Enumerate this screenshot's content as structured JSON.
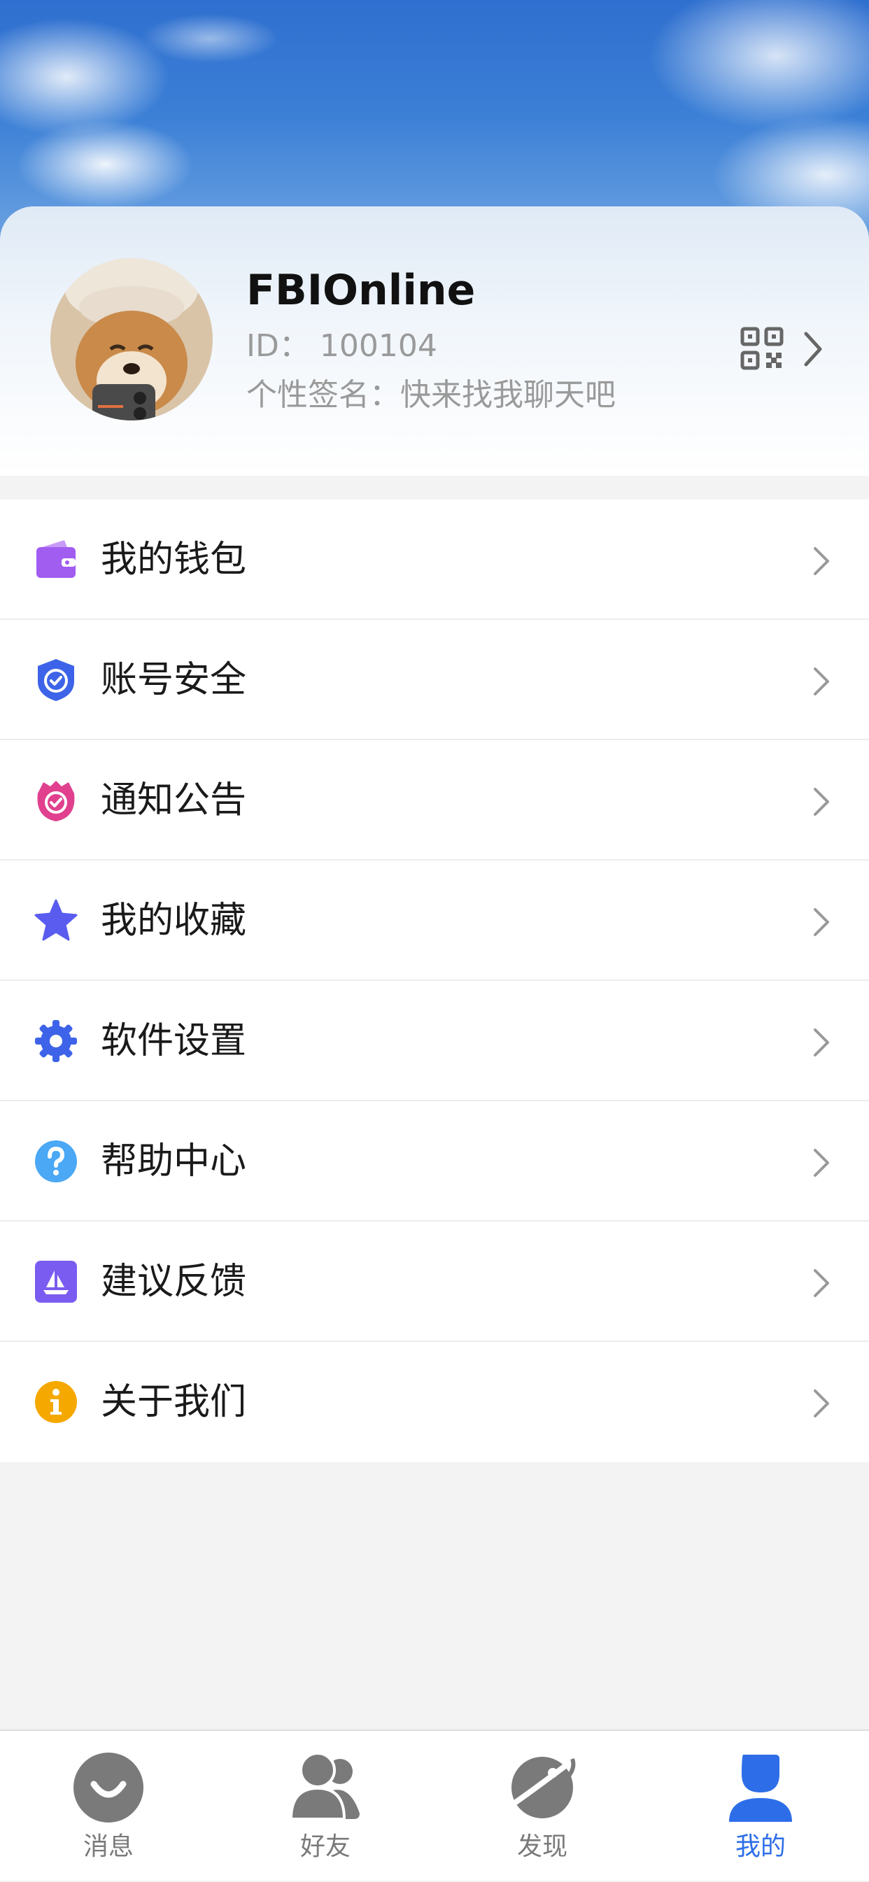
{
  "profile": {
    "nickname": "FBIOnline",
    "id_text": "ID：  100104",
    "signature_text": "个性签名：快来找我聊天吧"
  },
  "menu": [
    {
      "label": "我的钱包",
      "icon": "wallet-icon",
      "color": "#a15cf0"
    },
    {
      "label": "账号安全",
      "icon": "shield-check-icon",
      "color": "#3d63e8"
    },
    {
      "label": "通知公告",
      "icon": "notice-check-icon",
      "color": "#e0408e"
    },
    {
      "label": "我的收藏",
      "icon": "star-icon",
      "color": "#5a5cf0"
    },
    {
      "label": "软件设置",
      "icon": "gear-icon",
      "color": "#3d63e8"
    },
    {
      "label": "帮助中心",
      "icon": "help-icon",
      "color": "#4aa8f5"
    },
    {
      "label": "建议反馈",
      "icon": "feedback-icon",
      "color": "#7b5cf0"
    },
    {
      "label": "关于我们",
      "icon": "info-icon",
      "color": "#f5a800"
    }
  ],
  "tabs": [
    {
      "label": "消息",
      "icon": "message-icon",
      "active": false
    },
    {
      "label": "好友",
      "icon": "friends-icon",
      "active": false
    },
    {
      "label": "发现",
      "icon": "planet-icon",
      "active": false
    },
    {
      "label": "我的",
      "icon": "profile-icon",
      "active": true
    }
  ],
  "colors": {
    "accent": "#2d6ee8",
    "tab_inactive": "#7a7a7a"
  }
}
